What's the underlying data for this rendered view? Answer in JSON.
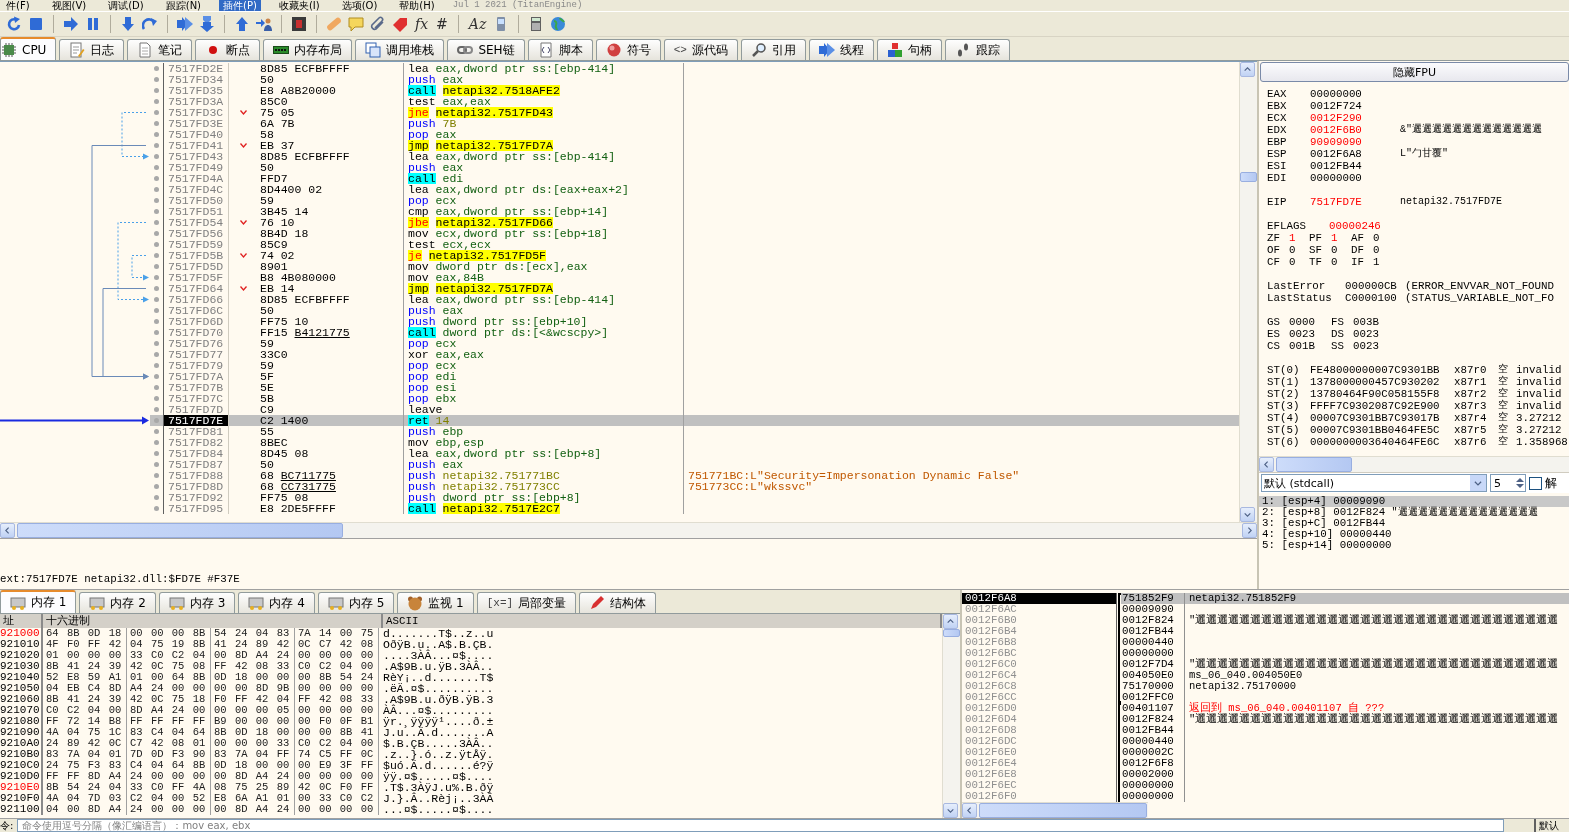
{
  "menu": [
    {
      "label": "件(F)",
      "selected": false
    },
    {
      "label": "视图(V)",
      "selected": false
    },
    {
      "label": "调试(D)",
      "selected": false
    },
    {
      "label": "跟踪(N)",
      "selected": false
    },
    {
      "label": "插件(P)",
      "selected": true
    },
    {
      "label": "收藏夹(I)",
      "selected": false
    },
    {
      "label": "选项(O)",
      "selected": false
    },
    {
      "label": "帮助(H)",
      "selected": false
    }
  ],
  "build_info": "Jul 1 2021 (TitanEngine)",
  "toolbar": [
    {
      "kind": "restart"
    },
    {
      "kind": "stop"
    },
    {
      "kind": "separator"
    },
    {
      "kind": "run"
    },
    {
      "kind": "pause"
    },
    {
      "kind": "separator"
    },
    {
      "kind": "step_into"
    },
    {
      "kind": "step_over"
    },
    {
      "kind": "separator"
    },
    {
      "kind": "trace_into"
    },
    {
      "kind": "trace_over"
    },
    {
      "kind": "separator"
    },
    {
      "kind": "up"
    },
    {
      "kind": "user_run"
    },
    {
      "kind": "separator"
    },
    {
      "kind": "s_box"
    },
    {
      "kind": "separator"
    },
    {
      "kind": "bandage"
    },
    {
      "kind": "comment"
    },
    {
      "kind": "clip"
    },
    {
      "kind": "label"
    },
    {
      "kind": "glyph",
      "text": "fx"
    },
    {
      "kind": "glyph",
      "text": "#"
    },
    {
      "kind": "separator"
    },
    {
      "kind": "glyph",
      "text": "Az"
    },
    {
      "kind": "phone"
    },
    {
      "kind": "separator"
    },
    {
      "kind": "calc"
    },
    {
      "kind": "globe"
    }
  ],
  "cpu_tabs": [
    {
      "label": "CPU",
      "selected": true
    },
    {
      "label": "日志",
      "selected": false
    },
    {
      "label": "笔记",
      "selected": false
    },
    {
      "label": "断点",
      "selected": false
    },
    {
      "label": "内存布局",
      "selected": false
    },
    {
      "label": "调用堆栈",
      "selected": false
    },
    {
      "label": "SEH链",
      "selected": false
    },
    {
      "label": "脚本",
      "selected": false
    },
    {
      "label": "符号",
      "selected": false
    },
    {
      "label": "源代码",
      "icon_text": "<>",
      "selected": false
    },
    {
      "label": "引用",
      "selected": false
    },
    {
      "label": "线程",
      "selected": false
    },
    {
      "label": "句柄",
      "selected": false
    },
    {
      "label": "跟踪",
      "selected": false
    }
  ],
  "disassembly": [
    {
      "address": "7517FD2E",
      "bytes": "8D85 ECFBFFFF",
      "mnemonic": {
        "text": "lea",
        "kind": "plain"
      },
      "operands": {
        "text": "eax,dword ptr ss:[ebp-414]",
        "kind": "plain"
      },
      "jump": false,
      "selected": false
    },
    {
      "address": "7517FD34",
      "bytes": "50",
      "mnemonic": {
        "text": "push",
        "kind": "stack"
      },
      "operands": {
        "text": "eax",
        "kind": "plain"
      },
      "jump": false,
      "selected": false
    },
    {
      "address": "7517FD35",
      "bytes": "E8 A8B20000",
      "mnemonic": {
        "text": "call",
        "kind": "call"
      },
      "operands": {
        "text": "netapi32.7518AFE2",
        "kind": "target"
      },
      "jump": false,
      "selected": false
    },
    {
      "address": "7517FD3A",
      "bytes": "85C0",
      "mnemonic": {
        "text": "test",
        "kind": "plain"
      },
      "operands": {
        "text": "eax,eax",
        "kind": "plain"
      },
      "jump": false,
      "selected": false
    },
    {
      "address": "7517FD3C",
      "bytes": "75 05",
      "mnemonic": {
        "text": "jne",
        "kind": "jcc"
      },
      "operands": {
        "text": "netapi32.7517FD43",
        "kind": "target"
      },
      "jump": true,
      "selected": false
    },
    {
      "address": "7517FD3E",
      "bytes": "6A 7B",
      "mnemonic": {
        "text": "push",
        "kind": "stack"
      },
      "operands": {
        "text": "7B",
        "kind": "number"
      },
      "jump": false,
      "selected": false
    },
    {
      "address": "7517FD40",
      "bytes": "58",
      "mnemonic": {
        "text": "pop",
        "kind": "stack"
      },
      "operands": {
        "text": "eax",
        "kind": "plain"
      },
      "jump": false,
      "selected": false
    },
    {
      "address": "7517FD41",
      "bytes": "EB 37",
      "mnemonic": {
        "text": "jmp",
        "kind": "jmp"
      },
      "operands": {
        "text": "netapi32.7517FD7A",
        "kind": "target"
      },
      "jump": true,
      "selected": false
    },
    {
      "address": "7517FD43",
      "bytes": "8D85 ECFBFFFF",
      "mnemonic": {
        "text": "lea",
        "kind": "plain"
      },
      "operands": {
        "text": "eax,dword ptr ss:[ebp-414]",
        "kind": "plain"
      },
      "jump": false,
      "selected": false
    },
    {
      "address": "7517FD49",
      "bytes": "50",
      "mnemonic": {
        "text": "push",
        "kind": "stack"
      },
      "operands": {
        "text": "eax",
        "kind": "plain"
      },
      "jump": false,
      "selected": false
    },
    {
      "address": "7517FD4A",
      "bytes": "FFD7",
      "mnemonic": {
        "text": "call",
        "kind": "call"
      },
      "operands": {
        "text": "edi",
        "kind": "plain"
      },
      "jump": false,
      "selected": false
    },
    {
      "address": "7517FD4C",
      "bytes": "8D4400 02",
      "mnemonic": {
        "text": "lea",
        "kind": "plain"
      },
      "operands": {
        "text": "eax,dword ptr ds:[eax+eax+2]",
        "kind": "plain"
      },
      "jump": false,
      "selected": false
    },
    {
      "address": "7517FD50",
      "bytes": "59",
      "mnemonic": {
        "text": "pop",
        "kind": "stack"
      },
      "operands": {
        "text": "ecx",
        "kind": "plain"
      },
      "jump": false,
      "selected": false
    },
    {
      "address": "7517FD51",
      "bytes": "3B45 14",
      "mnemonic": {
        "text": "cmp",
        "kind": "plain"
      },
      "operands": {
        "text": "eax,dword ptr ss:[ebp+14]",
        "kind": "plain"
      },
      "jump": false,
      "selected": false
    },
    {
      "address": "7517FD54",
      "bytes": "76 10",
      "mnemonic": {
        "text": "jbe",
        "kind": "jcc"
      },
      "operands": {
        "text": "netapi32.7517FD66",
        "kind": "target"
      },
      "jump": true,
      "selected": false
    },
    {
      "address": "7517FD56",
      "bytes": "8B4D 18",
      "mnemonic": {
        "text": "mov",
        "kind": "plain"
      },
      "operands": {
        "text": "ecx,dword ptr ss:[ebp+18]",
        "kind": "plain"
      },
      "jump": false,
      "selected": false
    },
    {
      "address": "7517FD59",
      "bytes": "85C9",
      "mnemonic": {
        "text": "test",
        "kind": "plain"
      },
      "operands": {
        "text": "ecx,ecx",
        "kind": "plain"
      },
      "jump": false,
      "selected": false
    },
    {
      "address": "7517FD5B",
      "bytes": "74 02",
      "mnemonic": {
        "text": "je",
        "kind": "jcc"
      },
      "operands": {
        "text": "netapi32.7517FD5F",
        "kind": "target"
      },
      "jump": true,
      "selected": false
    },
    {
      "address": "7517FD5D",
      "bytes": "8901",
      "mnemonic": {
        "text": "mov",
        "kind": "plain"
      },
      "operands": {
        "text": "dword ptr ds:[ecx],eax",
        "kind": "plain"
      },
      "jump": false,
      "selected": false
    },
    {
      "address": "7517FD5F",
      "bytes": "B8 4B080000",
      "mnemonic": {
        "text": "mov",
        "kind": "plain"
      },
      "operands": {
        "text": "eax,84B",
        "kind": "plain"
      },
      "jump": false,
      "selected": false
    },
    {
      "address": "7517FD64",
      "bytes": "EB 14",
      "mnemonic": {
        "text": "jmp",
        "kind": "jmp"
      },
      "operands": {
        "text": "netapi32.7517FD7A",
        "kind": "target"
      },
      "jump": true,
      "selected": false
    },
    {
      "address": "7517FD66",
      "bytes": "8D85 ECFBFFFF",
      "mnemonic": {
        "text": "lea",
        "kind": "plain"
      },
      "operands": {
        "text": "eax,dword ptr ss:[ebp-414]",
        "kind": "plain"
      },
      "jump": false,
      "selected": false
    },
    {
      "address": "7517FD6C",
      "bytes": "50",
      "mnemonic": {
        "text": "push",
        "kind": "stack"
      },
      "operands": {
        "text": "eax",
        "kind": "plain"
      },
      "jump": false,
      "selected": false
    },
    {
      "address": "7517FD6D",
      "bytes": "FF75 10",
      "mnemonic": {
        "text": "push",
        "kind": "stack"
      },
      "operands": {
        "text": "dword ptr ss:[ebp+10]",
        "kind": "plain"
      },
      "jump": false,
      "selected": false
    },
    {
      "address": "7517FD70",
      "bytes": "FF15",
      "ref": "B4121775",
      "mnemonic": {
        "text": "call",
        "kind": "call"
      },
      "operands": {
        "text": "dword ptr ds:[<&wcscpy>]",
        "kind": "plain"
      },
      "jump": false,
      "selected": false
    },
    {
      "address": "7517FD76",
      "bytes": "59",
      "mnemonic": {
        "text": "pop",
        "kind": "stack"
      },
      "operands": {
        "text": "ecx",
        "kind": "plain"
      },
      "jump": false,
      "selected": false
    },
    {
      "address": "7517FD77",
      "bytes": "33C0",
      "mnemonic": {
        "text": "xor",
        "kind": "plain"
      },
      "operands": {
        "text": "eax,eax",
        "kind": "plain"
      },
      "jump": false,
      "selected": false
    },
    {
      "address": "7517FD79",
      "bytes": "59",
      "mnemonic": {
        "text": "pop",
        "kind": "stack"
      },
      "operands": {
        "text": "ecx",
        "kind": "plain"
      },
      "jump": false,
      "selected": false
    },
    {
      "address": "7517FD7A",
      "bytes": "5F",
      "mnemonic": {
        "text": "pop",
        "kind": "stack"
      },
      "operands": {
        "text": "edi",
        "kind": "plain"
      },
      "jump": false,
      "selected": false
    },
    {
      "address": "7517FD7B",
      "bytes": "5E",
      "mnemonic": {
        "text": "pop",
        "kind": "stack"
      },
      "operands": {
        "text": "esi",
        "kind": "plain"
      },
      "jump": false,
      "selected": false
    },
    {
      "address": "7517FD7C",
      "bytes": "5B",
      "mnemonic": {
        "text": "pop",
        "kind": "stack"
      },
      "operands": {
        "text": "ebx",
        "kind": "plain"
      },
      "jump": false,
      "selected": false
    },
    {
      "address": "7517FD7D",
      "bytes": "C9",
      "mnemonic": {
        "text": "leave",
        "kind": "plain"
      },
      "jump": false,
      "selected": false
    },
    {
      "address": "7517FD7E",
      "bytes": "C2 1400",
      "mnemonic": {
        "text": "ret",
        "kind": "ret"
      },
      "operands": {
        "text": "14",
        "kind": "number"
      },
      "jump": false,
      "selected": true
    },
    {
      "address": "7517FD81",
      "bytes": "55",
      "mnemonic": {
        "text": "push",
        "kind": "stack"
      },
      "operands": {
        "text": "ebp",
        "kind": "plain"
      },
      "jump": false,
      "selected": false
    },
    {
      "address": "7517FD82",
      "bytes": "8BEC",
      "mnemonic": {
        "text": "mov",
        "kind": "plain"
      },
      "operands": {
        "text": "ebp,esp",
        "kind": "plain"
      },
      "jump": false,
      "selected": false
    },
    {
      "address": "7517FD84",
      "bytes": "8D45 08",
      "mnemonic": {
        "text": "lea",
        "kind": "plain"
      },
      "operands": {
        "text": "eax,dword ptr ss:[ebp+8]",
        "kind": "plain"
      },
      "jump": false,
      "selected": false
    },
    {
      "address": "7517FD87",
      "bytes": "50",
      "mnemonic": {
        "text": "push",
        "kind": "stack"
      },
      "operands": {
        "text": "eax",
        "kind": "plain"
      },
      "jump": false,
      "selected": false
    },
    {
      "address": "7517FD88",
      "bytes": "68",
      "ref": "BC711775",
      "mnemonic": {
        "text": "push",
        "kind": "stack"
      },
      "operands": {
        "text": "netapi32.751771BC",
        "kind": "number"
      },
      "comment": "751771BC:L\"Security=Impersonation Dynamic False\"",
      "jump": false,
      "selected": false
    },
    {
      "address": "7517FD8D",
      "bytes": "68",
      "ref": "CC731775",
      "mnemonic": {
        "text": "push",
        "kind": "stack"
      },
      "operands": {
        "text": "netapi32.751773CC",
        "kind": "number"
      },
      "comment": "751773CC:L\"wkssvc\"",
      "jump": false,
      "selected": false
    },
    {
      "address": "7517FD92",
      "bytes": "FF75 08",
      "mnemonic": {
        "text": "push",
        "kind": "stack"
      },
      "operands": {
        "text": "dword ptr ss:[ebp+8]",
        "kind": "plain"
      },
      "jump": false,
      "selected": false
    },
    {
      "address": "7517FD95",
      "bytes": "E8 2DE5FFFF",
      "mnemonic": {
        "text": "call",
        "kind": "call"
      },
      "operands": {
        "text": "netapi32.7517E2C7",
        "kind": "target"
      },
      "jump": false,
      "selected": false
    }
  ],
  "info_line": "ext:7517FD7E netapi32.dll:$FD7E #F37E",
  "fpu_toggle": "隐藏FPU",
  "registers": [
    {
      "name": "EAX",
      "value": "00000000",
      "changed": false
    },
    {
      "name": "EBX",
      "value": "0012F724",
      "changed": false
    },
    {
      "name": "ECX",
      "value": "0012F290",
      "changed": true
    },
    {
      "name": "EDX",
      "value": "0012F6B0",
      "changed": true,
      "comment": "&\"邐邐邐邐邐邐邐邐邐邐邐邐邐"
    },
    {
      "name": "EBP",
      "value": "90909090",
      "changed": true
    },
    {
      "name": "ESP",
      "value": "0012F6A8",
      "changed": false,
      "comment": "L\"勹甘覆\""
    },
    {
      "name": "ESI",
      "value": "0012FB44",
      "changed": false
    },
    {
      "name": "EDI",
      "value": "00000000",
      "changed": false
    }
  ],
  "eip": {
    "name": "EIP",
    "value": "7517FD7E",
    "changed": true,
    "comment": "netapi32.7517FD7E"
  },
  "eflags": {
    "name": "EFLAGS",
    "value": "00000246",
    "changed": true
  },
  "flags": [
    {
      "name": "ZF",
      "value": "1",
      "changed": true
    },
    {
      "name": "PF",
      "value": "1",
      "changed": true
    },
    {
      "name": "AF",
      "value": "0",
      "changed": false
    },
    {
      "name": "OF",
      "value": "0",
      "changed": false
    },
    {
      "name": "SF",
      "value": "0",
      "changed": false
    },
    {
      "name": "DF",
      "value": "0",
      "changed": false
    },
    {
      "name": "CF",
      "value": "0",
      "changed": false
    },
    {
      "name": "TF",
      "value": "0",
      "changed": false
    },
    {
      "name": "IF",
      "value": "1",
      "changed": false
    }
  ],
  "last_error": [
    {
      "name": "LastError",
      "value": "000000CB",
      "text": "(ERROR_ENVVAR_NOT_FOUND"
    },
    {
      "name": "LastStatus",
      "value": "C0000100",
      "text": "(STATUS_VARIABLE_NOT_FO"
    }
  ],
  "segments": [
    {
      "name": "GS",
      "value": "0000"
    },
    {
      "name": "FS",
      "value": "003B"
    },
    {
      "name": "ES",
      "value": "0023"
    },
    {
      "name": "DS",
      "value": "0023"
    },
    {
      "name": "CS",
      "value": "001B"
    },
    {
      "name": "SS",
      "value": "0023"
    }
  ],
  "fpu": [
    {
      "name": "ST(0)",
      "value": "FE48000000007C9301BB",
      "register": "x87r0",
      "tag": "空",
      "number": "invalid"
    },
    {
      "name": "ST(1)",
      "value": "1378000000457C930202",
      "register": "x87r1",
      "tag": "空",
      "number": "invalid"
    },
    {
      "name": "ST(2)",
      "value": "13780464F90C058155F8",
      "register": "x87r2",
      "tag": "空",
      "number": "invalid"
    },
    {
      "name": "ST(3)",
      "value": "FFFF7C9302087C92E900",
      "register": "x87r3",
      "tag": "空",
      "number": "invalid"
    },
    {
      "name": "ST(4)",
      "value": "00007C9301BB7C93017B",
      "register": "x87r4",
      "tag": "空",
      "number": "3.27212"
    },
    {
      "name": "ST(5)",
      "value": "00007C9301BB0464FE5C",
      "register": "x87r5",
      "tag": "空",
      "number": "3.27212"
    },
    {
      "name": "ST(6)",
      "value": "0000000003640464FE6C",
      "register": "x87r6",
      "tag": "空",
      "number": "1.358968"
    }
  ],
  "call_convention": "默认 (stdcall)",
  "arg_count": "5",
  "unlock": {
    "label": "解",
    "checked": false
  },
  "args": [
    {
      "index": "1:",
      "ref": "[esp+4]",
      "value": "00009090",
      "selected": true
    },
    {
      "index": "2:",
      "ref": "[esp+8]",
      "value": "0012F824",
      "comment": "\"邐邐邐邐邐邐邐邐邐邐邐邐邐邐",
      "selected": false
    },
    {
      "index": "3:",
      "ref": "[esp+C]",
      "value": "0012FB44",
      "selected": false
    },
    {
      "index": "4:",
      "ref": "[esp+10]",
      "value": "00000440",
      "selected": false
    },
    {
      "index": "5:",
      "ref": "[esp+14]",
      "value": "00000000",
      "selected": false
    }
  ],
  "dump_tabs": [
    {
      "label": "内存 1",
      "selected": true
    },
    {
      "label": "内存 2",
      "selected": false
    },
    {
      "label": "内存 3",
      "selected": false
    },
    {
      "label": "内存 4",
      "selected": false
    },
    {
      "label": "内存 5",
      "selected": false
    },
    {
      "label": "监视 1",
      "selected": false
    },
    {
      "label": "局部变量",
      "icon_text": "[x=]",
      "selected": false
    },
    {
      "label": "结构体",
      "selected": false
    }
  ],
  "dump": {
    "columns": [
      "址",
      "十六进制",
      "ASCII"
    ],
    "rows": [
      {
        "address": "921000",
        "marked": true,
        "hex": [
          "64 8B 0D 18",
          "00 00 00 8B",
          "54 24 04 83",
          "7A 14 00 75"
        ],
        "ascii": "d.......T$..z..u"
      },
      {
        "address": "921010",
        "marked": false,
        "hex": [
          "4F F0 FF 42",
          "04 75 19 8B",
          "41 24 89 42",
          "0C C7 42 08"
        ],
        "ascii": "OðÿB.u..A$.B.ÇB."
      },
      {
        "address": "921020",
        "marked": false,
        "hex": [
          "01 00 00 00",
          "33 C0 C2 04",
          "00 8D A4 24",
          "00 00 00 00"
        ],
        "ascii": "....3ÀÂ...¤$...."
      },
      {
        "address": "921030",
        "marked": false,
        "hex": [
          "8B 41 24 39",
          "42 0C 75 08",
          "FF 42 08 33",
          "C0 C2 04 00"
        ],
        "ascii": ".A$9B.u.ÿB.3ÀÂ.."
      },
      {
        "address": "921040",
        "marked": false,
        "hex": [
          "52 E8 59 A1",
          "01 00 64 8B",
          "0D 18 00 00",
          "00 8B 54 24"
        ],
        "ascii": "RèY¡..d.......T$"
      },
      {
        "address": "921050",
        "marked": false,
        "hex": [
          "04 EB C4 8D",
          "A4 24 00 00",
          "00 00 8D 9B",
          "00 00 00 00"
        ],
        "ascii": ".ëÄ.¤$.........."
      },
      {
        "address": "921060",
        "marked": false,
        "hex": [
          "8B 41 24 39",
          "42 0C 75 18",
          "F0 FF 42 04",
          "FF 42 08 33"
        ],
        "ascii": ".A$9B.u.ðÿB.ÿB.3"
      },
      {
        "address": "921070",
        "marked": false,
        "hex": [
          "C0 C2 04 00",
          "8D A4 24 00",
          "00 00 00 05",
          "00 00 00 00"
        ],
        "ascii": "ÀÂ...¤$........."
      },
      {
        "address": "921080",
        "marked": false,
        "hex": [
          "FF 72 14 B8",
          "FF FF FF FF",
          "B9 00 00 00",
          "00 F0 0F B1"
        ],
        "ascii": "ÿr.¸ÿÿÿÿ¹....ð.±"
      },
      {
        "address": "921090",
        "marked": false,
        "hex": [
          "4A 04 75 1C",
          "83 C4 04 64",
          "8B 0D 18 00",
          "00 00 8B 41"
        ],
        "ascii": "J.u..Ä.d.......A"
      },
      {
        "address": "9210A0",
        "marked": false,
        "hex": [
          "24 89 42 0C",
          "C7 42 08 01",
          "00 00 00 33",
          "C0 C2 04 00"
        ],
        "ascii": "$.B.ÇB.....3ÀÂ.."
      },
      {
        "address": "9210B0",
        "marked": false,
        "hex": [
          "83 7A 04 01",
          "7D 0D F3 90",
          "83 7A 04 FF",
          "74 C5 FF 0C"
        ],
        "ascii": ".z..}.ó..z.ÿtÅÿ."
      },
      {
        "address": "9210C0",
        "marked": false,
        "hex": [
          "24 75 F3 83",
          "C4 04 64 8B",
          "0D 18 00 00",
          "00 E9 3F FF"
        ],
        "ascii": "$uó.Ä.d......é?ÿ"
      },
      {
        "address": "9210D0",
        "marked": false,
        "hex": [
          "FF FF 8D A4",
          "24 00 00 00",
          "00 8D A4 24",
          "00 00 00 00"
        ],
        "ascii": "ÿÿ.¤$.....¤$...."
      },
      {
        "address": "9210E0",
        "marked": true,
        "hex": [
          "8B 54 24 04",
          "33 C0 FF 4A",
          "08 75 25 89",
          "42 0C F0 FF"
        ],
        "ascii": ".T$.3ÀÿJ.u%.B.ðÿ"
      },
      {
        "address": "9210F0",
        "marked": false,
        "hex": [
          "4A 04 7D 03",
          "C2 04 00 52",
          "E8 6A A1 01",
          "00 33 C0 C2"
        ],
        "ascii": "J.}.Â..Rèj¡..3ÀÂ"
      },
      {
        "address": "921100",
        "marked": false,
        "hex": [
          "04 00 8D A4",
          "24 00 00 00",
          "00 8D A4 24",
          "00 00 00 00"
        ],
        "ascii": "...¤$.....¤$...."
      }
    ]
  },
  "stack": [
    {
      "address": "0012F6A8",
      "value": "751852F9",
      "kind": "frame_start",
      "comment": {
        "text": "netapi32.751852F9",
        "kind": "plain"
      },
      "selected": true
    },
    {
      "address": "0012F6AC",
      "value": "00009090",
      "kind": "frame_body",
      "selected": false
    },
    {
      "address": "0012F6B0",
      "value": "0012F824",
      "kind": "frame_body",
      "comment": {
        "text": "\"邐邐邐邐邐邐邐邐邐邐邐邐邐邐邐邐邐邐邐邐邐邐邐邐邐邐邐邐邐邐邐邐邐",
        "kind": "plain"
      },
      "selected": false
    },
    {
      "address": "0012F6B4",
      "value": "0012FB44",
      "kind": "frame_body",
      "selected": false
    },
    {
      "address": "0012F6B8",
      "value": "00000440",
      "kind": "frame_body",
      "selected": false
    },
    {
      "address": "0012F6BC",
      "value": "00000000",
      "kind": "frame_body",
      "selected": false
    },
    {
      "address": "0012F6C0",
      "value": "0012F7D4",
      "kind": "frame_body",
      "comment": {
        "text": "\"邐邐邐邐邐邐邐邐邐邐邐邐邐邐邐邐邐邐邐邐邐邐邐邐邐邐邐邐邐邐邐邐邐",
        "kind": "plain"
      },
      "selected": false
    },
    {
      "address": "0012F6C4",
      "value": "004050E0",
      "kind": "frame_body",
      "comment": {
        "text": "ms_06_040.004050E0",
        "kind": "plain"
      },
      "selected": false
    },
    {
      "address": "0012F6C8",
      "value": "75170000",
      "kind": "frame_body",
      "comment": {
        "text": "netapi32.75170000",
        "kind": "plain"
      },
      "selected": false
    },
    {
      "address": "0012F6CC",
      "value": "0012FFC0",
      "kind": "frame_end",
      "selected": false
    },
    {
      "address": "0012F6D0",
      "value": "00401107",
      "kind": "frame_start",
      "comment": {
        "text": "返回到 ms_06_040.00401107 自 ???",
        "kind": "return"
      },
      "selected": false
    },
    {
      "address": "0012F6D4",
      "value": "0012F824",
      "kind": "frame_body",
      "comment": {
        "text": "\"邐邐邐邐邐邐邐邐邐邐邐邐邐邐邐邐邐邐邐邐邐邐邐邐邐邐邐邐邐邐邐邐邐",
        "kind": "plain"
      },
      "selected": false
    },
    {
      "address": "0012F6D8",
      "value": "0012FB44",
      "kind": "frame_body",
      "selected": false
    },
    {
      "address": "0012F6DC",
      "value": "00000440",
      "kind": "frame_body",
      "selected": false
    },
    {
      "address": "0012F6E0",
      "value": "0000002C",
      "kind": "frame_body",
      "selected": false
    },
    {
      "address": "0012F6E4",
      "value": "0012F6F8",
      "kind": "frame_body",
      "selected": false
    },
    {
      "address": "0012F6E8",
      "value": "00002000",
      "kind": "frame_body",
      "selected": false
    },
    {
      "address": "0012F6EC",
      "value": "00000000",
      "kind": "frame_body",
      "selected": false
    },
    {
      "address": "0012F6F0",
      "value": "00000000",
      "kind": "frame_body",
      "selected": false
    }
  ],
  "command": {
    "label": "令:",
    "placeholder": "命令使用逗号分隔（像汇编语言）：mov eax, ebx"
  },
  "mode": "默认"
}
